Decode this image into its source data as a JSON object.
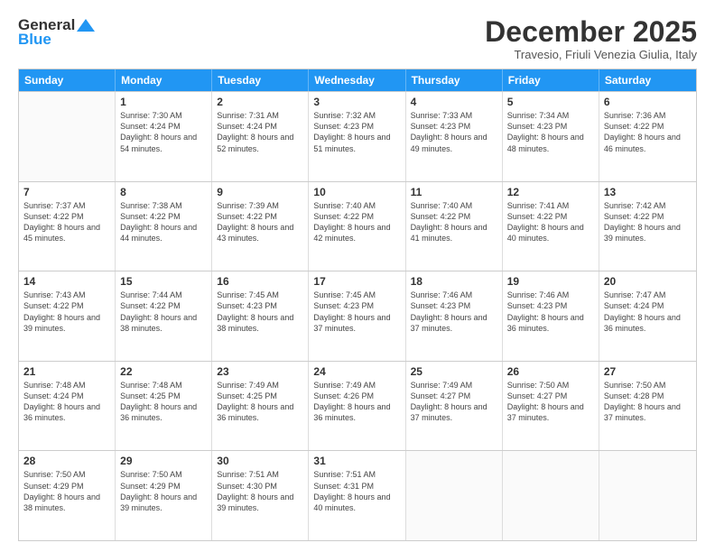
{
  "logo": {
    "general": "General",
    "blue": "Blue"
  },
  "header": {
    "month": "December 2025",
    "location": "Travesio, Friuli Venezia Giulia, Italy"
  },
  "days_of_week": [
    "Sunday",
    "Monday",
    "Tuesday",
    "Wednesday",
    "Thursday",
    "Friday",
    "Saturday"
  ],
  "rows": [
    [
      {
        "day": "",
        "sunrise": "",
        "sunset": "",
        "daylight": ""
      },
      {
        "day": "1",
        "sunrise": "Sunrise: 7:30 AM",
        "sunset": "Sunset: 4:24 PM",
        "daylight": "Daylight: 8 hours and 54 minutes."
      },
      {
        "day": "2",
        "sunrise": "Sunrise: 7:31 AM",
        "sunset": "Sunset: 4:24 PM",
        "daylight": "Daylight: 8 hours and 52 minutes."
      },
      {
        "day": "3",
        "sunrise": "Sunrise: 7:32 AM",
        "sunset": "Sunset: 4:23 PM",
        "daylight": "Daylight: 8 hours and 51 minutes."
      },
      {
        "day": "4",
        "sunrise": "Sunrise: 7:33 AM",
        "sunset": "Sunset: 4:23 PM",
        "daylight": "Daylight: 8 hours and 49 minutes."
      },
      {
        "day": "5",
        "sunrise": "Sunrise: 7:34 AM",
        "sunset": "Sunset: 4:23 PM",
        "daylight": "Daylight: 8 hours and 48 minutes."
      },
      {
        "day": "6",
        "sunrise": "Sunrise: 7:36 AM",
        "sunset": "Sunset: 4:22 PM",
        "daylight": "Daylight: 8 hours and 46 minutes."
      }
    ],
    [
      {
        "day": "7",
        "sunrise": "Sunrise: 7:37 AM",
        "sunset": "Sunset: 4:22 PM",
        "daylight": "Daylight: 8 hours and 45 minutes."
      },
      {
        "day": "8",
        "sunrise": "Sunrise: 7:38 AM",
        "sunset": "Sunset: 4:22 PM",
        "daylight": "Daylight: 8 hours and 44 minutes."
      },
      {
        "day": "9",
        "sunrise": "Sunrise: 7:39 AM",
        "sunset": "Sunset: 4:22 PM",
        "daylight": "Daylight: 8 hours and 43 minutes."
      },
      {
        "day": "10",
        "sunrise": "Sunrise: 7:40 AM",
        "sunset": "Sunset: 4:22 PM",
        "daylight": "Daylight: 8 hours and 42 minutes."
      },
      {
        "day": "11",
        "sunrise": "Sunrise: 7:40 AM",
        "sunset": "Sunset: 4:22 PM",
        "daylight": "Daylight: 8 hours and 41 minutes."
      },
      {
        "day": "12",
        "sunrise": "Sunrise: 7:41 AM",
        "sunset": "Sunset: 4:22 PM",
        "daylight": "Daylight: 8 hours and 40 minutes."
      },
      {
        "day": "13",
        "sunrise": "Sunrise: 7:42 AM",
        "sunset": "Sunset: 4:22 PM",
        "daylight": "Daylight: 8 hours and 39 minutes."
      }
    ],
    [
      {
        "day": "14",
        "sunrise": "Sunrise: 7:43 AM",
        "sunset": "Sunset: 4:22 PM",
        "daylight": "Daylight: 8 hours and 39 minutes."
      },
      {
        "day": "15",
        "sunrise": "Sunrise: 7:44 AM",
        "sunset": "Sunset: 4:22 PM",
        "daylight": "Daylight: 8 hours and 38 minutes."
      },
      {
        "day": "16",
        "sunrise": "Sunrise: 7:45 AM",
        "sunset": "Sunset: 4:23 PM",
        "daylight": "Daylight: 8 hours and 38 minutes."
      },
      {
        "day": "17",
        "sunrise": "Sunrise: 7:45 AM",
        "sunset": "Sunset: 4:23 PM",
        "daylight": "Daylight: 8 hours and 37 minutes."
      },
      {
        "day": "18",
        "sunrise": "Sunrise: 7:46 AM",
        "sunset": "Sunset: 4:23 PM",
        "daylight": "Daylight: 8 hours and 37 minutes."
      },
      {
        "day": "19",
        "sunrise": "Sunrise: 7:46 AM",
        "sunset": "Sunset: 4:23 PM",
        "daylight": "Daylight: 8 hours and 36 minutes."
      },
      {
        "day": "20",
        "sunrise": "Sunrise: 7:47 AM",
        "sunset": "Sunset: 4:24 PM",
        "daylight": "Daylight: 8 hours and 36 minutes."
      }
    ],
    [
      {
        "day": "21",
        "sunrise": "Sunrise: 7:48 AM",
        "sunset": "Sunset: 4:24 PM",
        "daylight": "Daylight: 8 hours and 36 minutes."
      },
      {
        "day": "22",
        "sunrise": "Sunrise: 7:48 AM",
        "sunset": "Sunset: 4:25 PM",
        "daylight": "Daylight: 8 hours and 36 minutes."
      },
      {
        "day": "23",
        "sunrise": "Sunrise: 7:49 AM",
        "sunset": "Sunset: 4:25 PM",
        "daylight": "Daylight: 8 hours and 36 minutes."
      },
      {
        "day": "24",
        "sunrise": "Sunrise: 7:49 AM",
        "sunset": "Sunset: 4:26 PM",
        "daylight": "Daylight: 8 hours and 36 minutes."
      },
      {
        "day": "25",
        "sunrise": "Sunrise: 7:49 AM",
        "sunset": "Sunset: 4:27 PM",
        "daylight": "Daylight: 8 hours and 37 minutes."
      },
      {
        "day": "26",
        "sunrise": "Sunrise: 7:50 AM",
        "sunset": "Sunset: 4:27 PM",
        "daylight": "Daylight: 8 hours and 37 minutes."
      },
      {
        "day": "27",
        "sunrise": "Sunrise: 7:50 AM",
        "sunset": "Sunset: 4:28 PM",
        "daylight": "Daylight: 8 hours and 37 minutes."
      }
    ],
    [
      {
        "day": "28",
        "sunrise": "Sunrise: 7:50 AM",
        "sunset": "Sunset: 4:29 PM",
        "daylight": "Daylight: 8 hours and 38 minutes."
      },
      {
        "day": "29",
        "sunrise": "Sunrise: 7:50 AM",
        "sunset": "Sunset: 4:29 PM",
        "daylight": "Daylight: 8 hours and 39 minutes."
      },
      {
        "day": "30",
        "sunrise": "Sunrise: 7:51 AM",
        "sunset": "Sunset: 4:30 PM",
        "daylight": "Daylight: 8 hours and 39 minutes."
      },
      {
        "day": "31",
        "sunrise": "Sunrise: 7:51 AM",
        "sunset": "Sunset: 4:31 PM",
        "daylight": "Daylight: 8 hours and 40 minutes."
      },
      {
        "day": "",
        "sunrise": "",
        "sunset": "",
        "daylight": ""
      },
      {
        "day": "",
        "sunrise": "",
        "sunset": "",
        "daylight": ""
      },
      {
        "day": "",
        "sunrise": "",
        "sunset": "",
        "daylight": ""
      }
    ]
  ]
}
